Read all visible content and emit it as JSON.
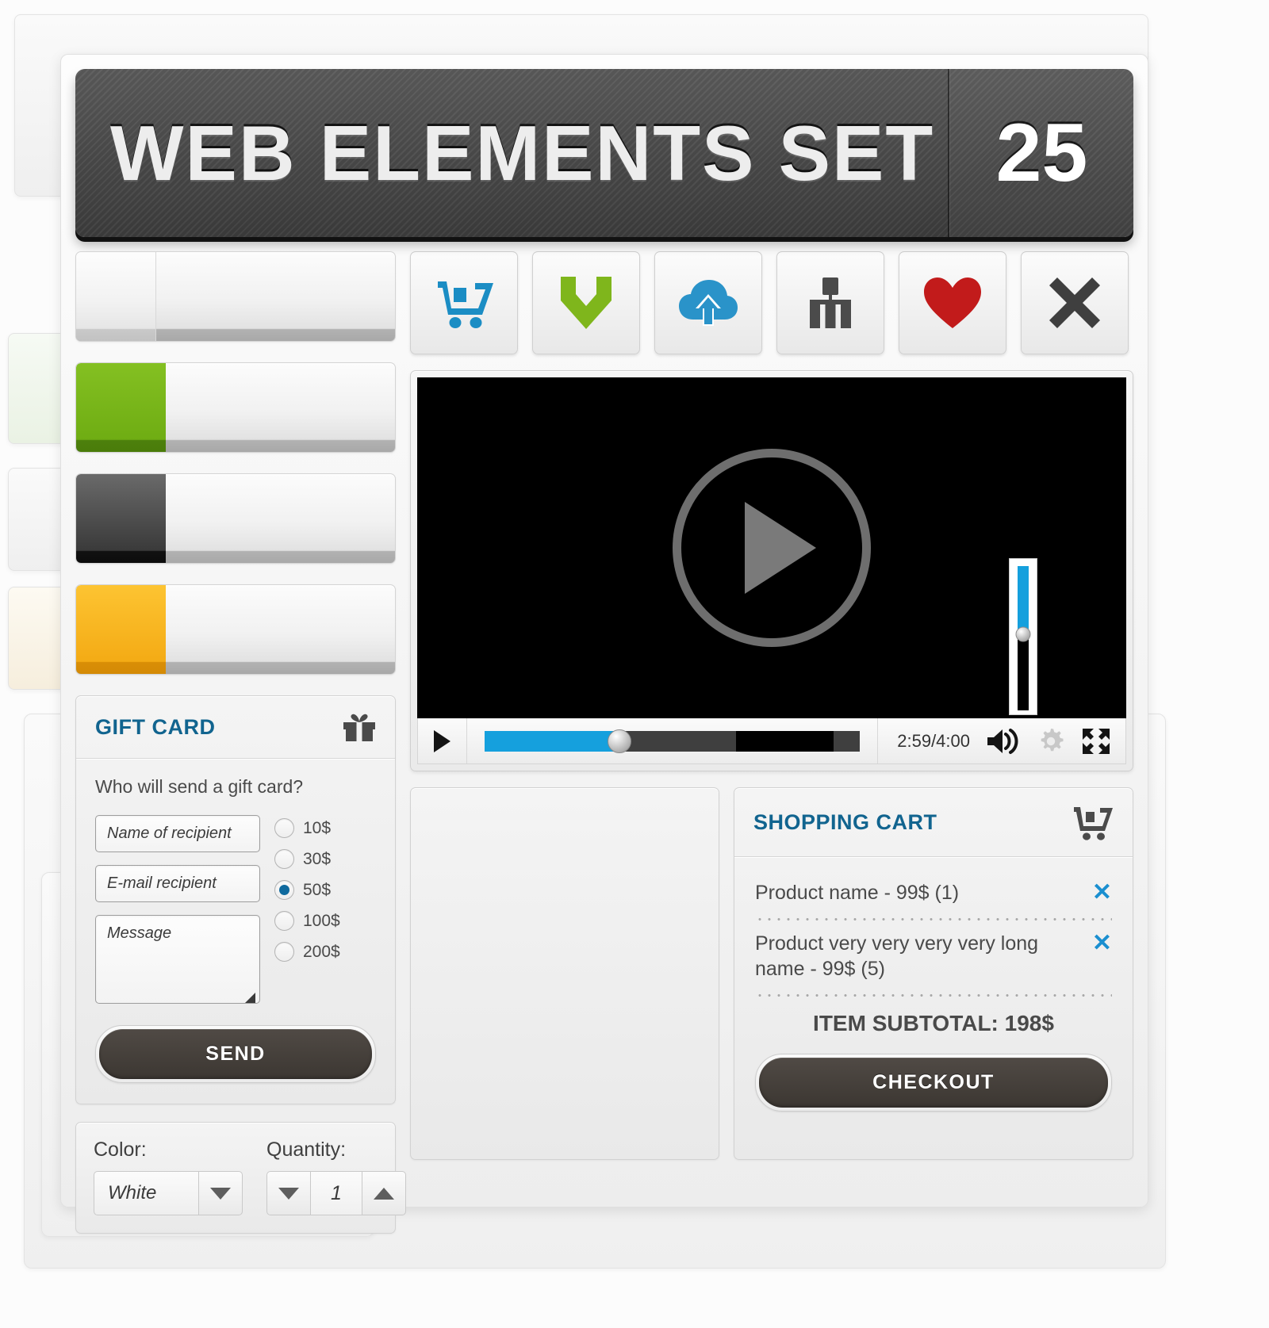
{
  "banner": {
    "title": "WEB ELEMENTS SET",
    "number": "25"
  },
  "progress_bars": [
    {
      "name": "progress-bar-plain",
      "percent": 25,
      "color": "plain"
    },
    {
      "name": "progress-bar-green",
      "percent": 28,
      "color": "green"
    },
    {
      "name": "progress-bar-dark",
      "percent": 28,
      "color": "dark"
    },
    {
      "name": "progress-bar-orange",
      "percent": 28,
      "color": "orange"
    }
  ],
  "icon_buttons": [
    {
      "icon": "shopping-cart-icon",
      "color": "#1b8dc4"
    },
    {
      "icon": "download-chevron-icon",
      "color": "#7fb61c"
    },
    {
      "icon": "cloud-upload-icon",
      "color": "#2a93c9"
    },
    {
      "icon": "sitemap-icon",
      "color": "#4b4b4b"
    },
    {
      "icon": "heart-icon",
      "color": "#c21b1b"
    },
    {
      "icon": "close-x-icon",
      "color": "#3f3f3f"
    }
  ],
  "gift_card": {
    "title": "GIFT CARD",
    "icon": "gift-icon",
    "question": "Who will send a gift card?",
    "name_placeholder": "Name of recipient",
    "email_placeholder": "E-mail recipient",
    "message_placeholder": "Message",
    "amounts": [
      {
        "label": "10$",
        "selected": false
      },
      {
        "label": "30$",
        "selected": false
      },
      {
        "label": "50$",
        "selected": true
      },
      {
        "label": "100$",
        "selected": false
      },
      {
        "label": "200$",
        "selected": false
      }
    ],
    "send_label": "SEND"
  },
  "color_quantity": {
    "color_label": "Color:",
    "color_value": "White",
    "quantity_label": "Quantity:",
    "quantity_value": "1"
  },
  "player": {
    "play_icon": "play-icon",
    "current_time": "2:59",
    "total_time": "4:00",
    "time_display": "2:59/4:00",
    "progress_percent": 36,
    "buffered_percent": 67,
    "volume_percent": 53,
    "volume_icon": "volume-icon",
    "settings_icon": "gear-icon",
    "fullscreen_icon": "fullscreen-icon",
    "accent_color": "#15a0dd"
  },
  "cart": {
    "title": "SHOPPING CART",
    "icon": "cart-icon",
    "items": [
      {
        "name": "Product name - 99$ (1)",
        "remove": "✕"
      },
      {
        "name": "Product very very very very long name - 99$ (5)",
        "remove": "✕"
      }
    ],
    "subtotal": "ITEM SUBTOTAL: 198$",
    "checkout_label": "CHECKOUT"
  }
}
